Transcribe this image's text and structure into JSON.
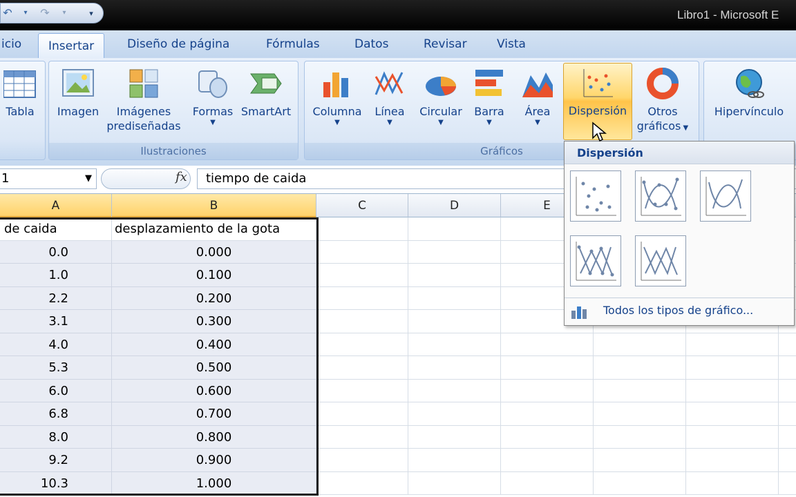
{
  "window": {
    "title": "Libro1 - Microsoft E"
  },
  "tabs": [
    "icio",
    "Insertar",
    "Diseño de página",
    "Fórmulas",
    "Datos",
    "Revisar",
    "Vista"
  ],
  "ribbon": {
    "tablas": {
      "tabla": "Tabla"
    },
    "ilustraciones": {
      "label": "Ilustraciones",
      "imagen": "Imagen",
      "imagenes_line1": "Imágenes",
      "imagenes_line2": "prediseñadas",
      "formas": "Formas",
      "smartart": "SmartArt"
    },
    "graficos": {
      "label": "Gráficos",
      "columna": "Columna",
      "linea": "Línea",
      "circular": "Circular",
      "barra": "Barra",
      "area": "Área",
      "dispersion": "Dispersión",
      "otros_line1": "Otros",
      "otros_line2": "gráficos"
    },
    "vinculos": {
      "hipervinculo": "Hipervínculo"
    }
  },
  "formula_bar": {
    "name_box": "1",
    "fx": "fx",
    "content": "tiempo de caida"
  },
  "columns": [
    "A",
    "B",
    "C",
    "D",
    "E"
  ],
  "table": {
    "headers": [
      "de caida",
      "desplazamiento de la gota"
    ],
    "rows": [
      [
        "0.0",
        "0.000"
      ],
      [
        "1.0",
        "0.100"
      ],
      [
        "2.2",
        "0.200"
      ],
      [
        "3.1",
        "0.300"
      ],
      [
        "4.0",
        "0.400"
      ],
      [
        "5.3",
        "0.500"
      ],
      [
        "6.0",
        "0.600"
      ],
      [
        "6.8",
        "0.700"
      ],
      [
        "8.0",
        "0.800"
      ],
      [
        "9.2",
        "0.900"
      ],
      [
        "10.3",
        "1.000"
      ]
    ]
  },
  "dropdown": {
    "title": "Dispersión",
    "footer": "Todos los tipos de gráfico..."
  }
}
